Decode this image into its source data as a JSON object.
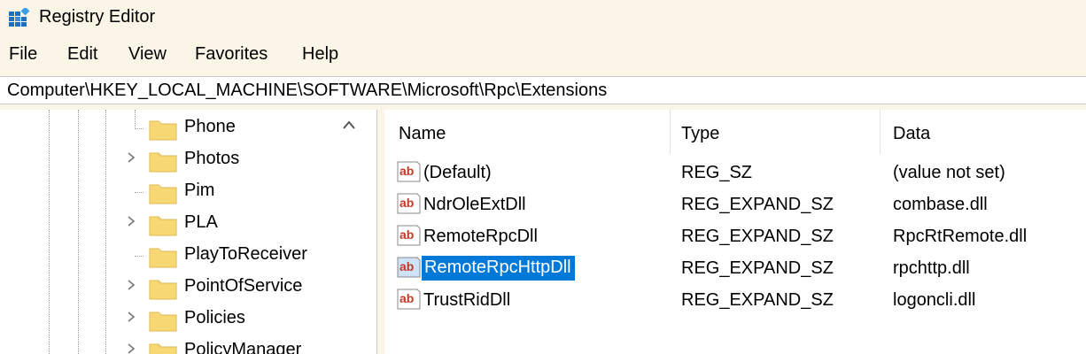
{
  "window": {
    "title": "Registry Editor"
  },
  "menu": {
    "items": [
      "File",
      "Edit",
      "View",
      "Favorites",
      "Help"
    ]
  },
  "address": {
    "path": "Computer\\HKEY_LOCAL_MACHINE\\SOFTWARE\\Microsoft\\Rpc\\Extensions"
  },
  "tree": {
    "items": [
      {
        "label": "Phone",
        "expandable": false
      },
      {
        "label": "Photos",
        "expandable": true
      },
      {
        "label": "Pim",
        "expandable": false
      },
      {
        "label": "PLA",
        "expandable": true
      },
      {
        "label": "PlayToReceiver",
        "expandable": false
      },
      {
        "label": "PointOfService",
        "expandable": true
      },
      {
        "label": "Policies",
        "expandable": true
      },
      {
        "label": "PolicyManager",
        "expandable": true
      }
    ]
  },
  "values": {
    "columns": {
      "name": "Name",
      "type": "Type",
      "data": "Data"
    },
    "rows": [
      {
        "name": "(Default)",
        "type": "REG_SZ",
        "data": "(value not set)",
        "selected": false
      },
      {
        "name": "NdrOleExtDll",
        "type": "REG_EXPAND_SZ",
        "data": "combase.dll",
        "selected": false
      },
      {
        "name": "RemoteRpcDll",
        "type": "REG_EXPAND_SZ",
        "data": "RpcRtRemote.dll",
        "selected": false
      },
      {
        "name": "RemoteRpcHttpDll",
        "type": "REG_EXPAND_SZ",
        "data": "rpchttp.dll",
        "selected": true
      },
      {
        "name": "TrustRidDll",
        "type": "REG_EXPAND_SZ",
        "data": "logoncli.dll",
        "selected": false
      }
    ]
  },
  "colors": {
    "selection": "#0078d7",
    "folder": "#f8d775",
    "background": "#faf5e6"
  }
}
